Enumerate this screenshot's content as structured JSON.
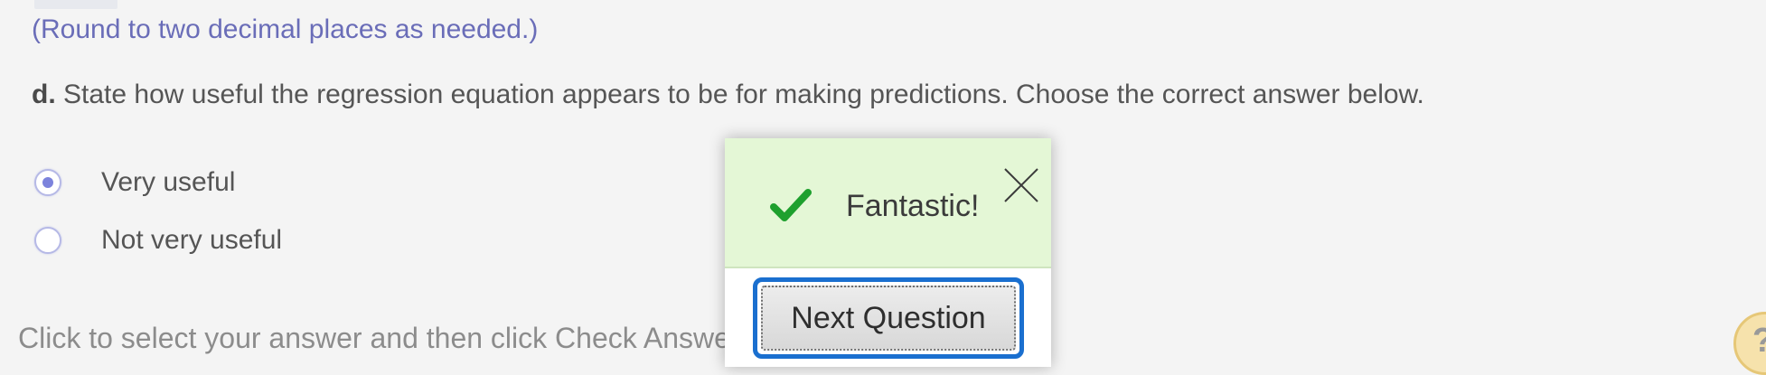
{
  "hint": {
    "text": "(Round to two decimal places as needed.)"
  },
  "question": {
    "letter": "d.",
    "text": "State how useful the regression equation appears to be for making predictions. Choose the correct answer below."
  },
  "options": [
    {
      "label": "Very useful",
      "selected": true
    },
    {
      "label": "Not very useful",
      "selected": false
    }
  ],
  "footer": {
    "instruction": "Click to select your answer and then click Check Answer."
  },
  "feedback_popup": {
    "message": "Fantastic!",
    "next_button_label": "Next Question"
  },
  "help": {
    "label": "?"
  },
  "colors": {
    "hint_text": "#6a6db8",
    "radio_selected": "#7c83dc",
    "success_green": "#1ea02e",
    "popup_header_bg": "#e4f7d6",
    "focus_ring": "#1a6fcf"
  },
  "icons": {
    "check": "check-icon",
    "close": "close-icon",
    "help": "help-icon"
  }
}
